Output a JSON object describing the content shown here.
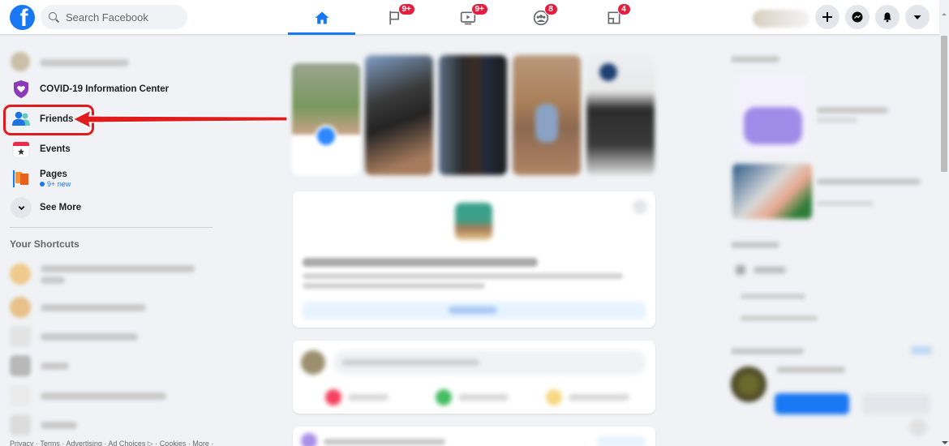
{
  "app": "Facebook",
  "topbar": {
    "search_placeholder": "Search Facebook",
    "tabs": [
      {
        "name": "home",
        "icon": "home-icon",
        "active": true,
        "badge": null
      },
      {
        "name": "pages",
        "icon": "flag-icon",
        "active": false,
        "badge": "9+"
      },
      {
        "name": "watch",
        "icon": "video-icon",
        "active": false,
        "badge": "9+"
      },
      {
        "name": "groups",
        "icon": "groups-icon",
        "active": false,
        "badge": "8"
      },
      {
        "name": "gaming",
        "icon": "gaming-icon",
        "active": false,
        "badge": "4"
      }
    ],
    "actions": [
      "create-icon",
      "messenger-icon",
      "notifications-icon",
      "account-menu-icon"
    ]
  },
  "sidebar": {
    "items": [
      {
        "label": "COVID-19 Information Center",
        "icon": "covid-shield-icon"
      },
      {
        "label": "Friends",
        "icon": "friends-icon",
        "highlighted": true
      },
      {
        "label": "Events",
        "icon": "events-calendar-icon"
      },
      {
        "label": "Pages",
        "icon": "pages-flag-icon",
        "sub": "9+ new"
      },
      {
        "label": "See More",
        "icon": "chevron-down-icon"
      }
    ],
    "shortcuts_title": "Your Shortcuts",
    "footer": "Privacy · Terms · Advertising · Ad Choices ▷ · Cookies · More ·"
  },
  "colors": {
    "brand": "#1877f2",
    "badge": "#e41e3f",
    "annotation": "#e01b1b",
    "background": "#f0f2f5"
  }
}
